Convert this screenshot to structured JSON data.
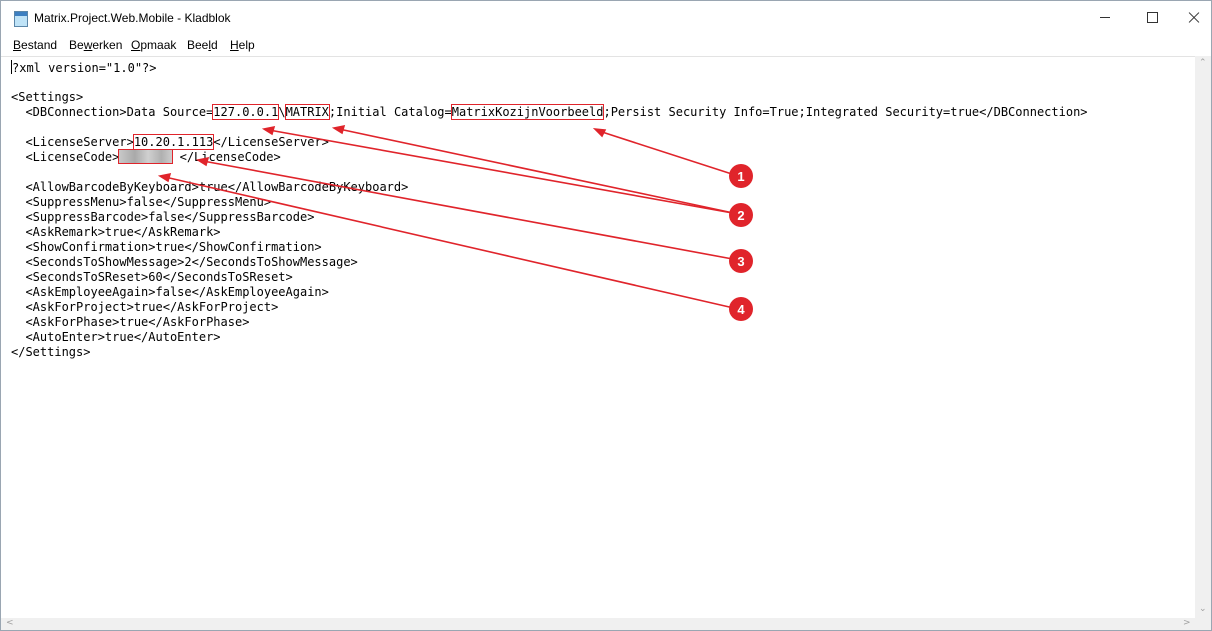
{
  "window": {
    "title": "Matrix.Project.Web.Mobile - Kladblok",
    "controls": {
      "minimize": "minimize",
      "maximize": "maximize",
      "close": "close"
    }
  },
  "menu": [
    {
      "pre": "",
      "acc": "B",
      "post": "estand"
    },
    {
      "pre": "Be",
      "acc": "w",
      "post": "erken"
    },
    {
      "pre": "",
      "acc": "O",
      "post": "pmaak"
    },
    {
      "pre": "Bee",
      "acc": "l",
      "post": "d"
    },
    {
      "pre": "",
      "acc": "H",
      "post": "elp"
    }
  ],
  "editor": {
    "xml_decl": "?xml version=\"1.0\"?>",
    "settings_open": "<Settings>",
    "db_prefix": "  <DBConnection>Data Source=",
    "db_ip": "127.0.0.1",
    "db_sep": "\\",
    "db_instance": "MATRIX",
    "db_mid": ";Initial Catalog=",
    "db_catalog": "MatrixKozijnVoorbeeld",
    "db_suffix": ";Persist Security Info=True;Integrated Security=true</DBConnection>",
    "ls_prefix": "  <LicenseServer>",
    "ls_ip": "10.20.1.113",
    "ls_suffix": "</LicenseServer>",
    "lc_prefix": "  <LicenseCode>",
    "lc_suffix": " </LicenseCode>",
    "lines": [
      "  <AllowBarcodeByKeyboard>true</AllowBarcodeByKeyboard>",
      "  <SuppressMenu>false</SuppressMenu>",
      "  <SuppressBarcode>false</SuppressBarcode>",
      "  <AskRemark>true</AskRemark>",
      "  <ShowConfirmation>true</ShowConfirmation>",
      "  <SecondsToShowMessage>2</SecondsToShowMessage>",
      "  <SecondsToSReset>60</SecondsToSReset>",
      "  <AskEmployeeAgain>false</AskEmployeeAgain>",
      "  <AskForProject>true</AskForProject>",
      "  <AskForPhase>true</AskForPhase>",
      "  <AutoEnter>true</AutoEnter>"
    ],
    "settings_close": "</Settings>"
  },
  "annotations": {
    "color": "#e0242b",
    "badges": [
      "1",
      "2",
      "3",
      "4"
    ]
  }
}
